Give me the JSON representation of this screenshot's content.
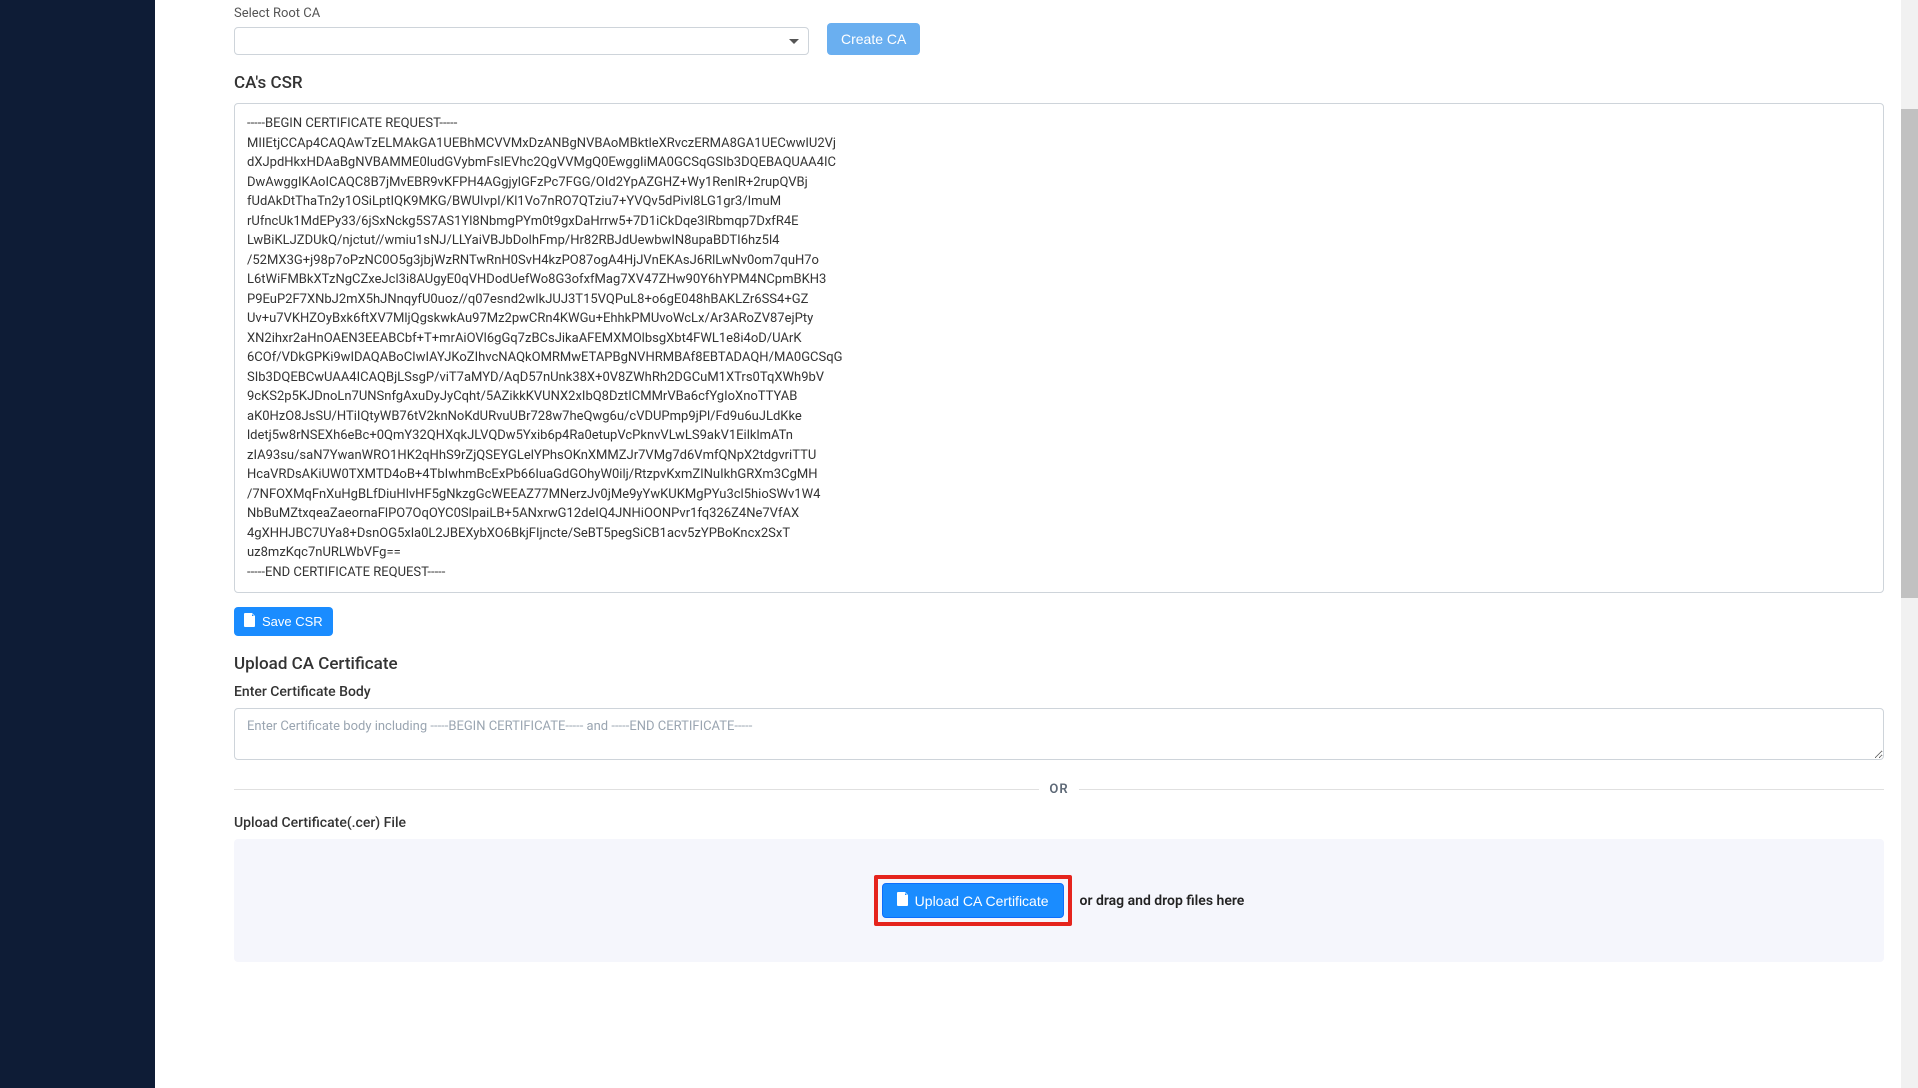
{
  "rootCa": {
    "label": "Select Root CA",
    "value": ""
  },
  "createCaBtn": "Create CA",
  "csr": {
    "heading": "CA's CSR",
    "body": "-----BEGIN CERTIFICATE REQUEST-----\nMIIEtjCCAp4CAQAwTzELMAkGA1UEBhMCVVMxDzANBgNVBAoMBktleXRvczERMA8GA1UECwwIU2Vj\ndXJpdHkxHDAaBgNVBAMME0ludGVybmFsIEVhc2QgVVMgQ0EwggIiMA0GCSqGSIb3DQEBAQUAA4IC\nDwAwggIKAoICAQC8B7jMvEBR9vKFPH4AGgjylGFzPc7FGG/OId2YpAZGHZ+Wy1RenIR+2rupQVBj\nfUdAkDtThaTn2y1OSiLptIQK9MKG/BWUIvpI/Kl1Vo7nRO7QTziu7+YVQv5dPivl8LG1gr3/ImuM\nrUfncUk1MdEPy33/6jSxNckg5S7AS1Yl8NbmgPYm0t9gxDaHrrw5+7D1iCkDqe3lRbmqp7DxfR4E\nLwBiKLJZDUkQ/njctut//wmiu1sNJ/LLYaiVBJbDolhFmp/Hr82RBJdUewbwIN8upaBDTI6hz5l4\n/52MX3G+j98p7oPzNC0O5g3jbjWzRNTwRnH0SvH4kzPO87ogA4HjJVnEKAsJ6RlLwNv0om7quH7o\nL6tWiFMBkXTzNgCZxeJcl3i8AUgyE0qVHDodUefWo8G3ofxfMag7XV47ZHw90Y6hYPM4NCpmBKH3\nP9EuP2F7XNbJ2mX5hJNnqyfU0uoz//q07esnd2wIkJUJ3T15VQPuL8+o6gE048hBAKLZr6SS4+GZ\nUv+u7VKHZOyBxk6ftXV7MljQgskwkAu97Mz2pwCRn4KWGu+EhhkPMUvoWcLx/Ar3ARoZV87ejPty\nXN2ihxr2aHnOAEN3EEABCbf+T+mrAiOVl6gGq7zBCsJikaAFEMXMOlbsgXbt4FWL1e8i4oD/UArK\n6COf/VDkGPKi9wIDAQABoCIwIAYJKoZIhvcNAQkOMRMwETAPBgNVHRMBAf8EBTADAQH/MA0GCSqG\nSIb3DQEBCwUAA4ICAQBjLSsgP/viT7aMYD/AqD57nUnk38X+0V8ZWhRh2DGCuM1XTrs0TqXWh9bV\n9cKS2p5KJDnoLn7UNSnfgAxuDyJyCqht/5AZikkKVUNX2xIbQ8DztICMMrVBa6cfYgIoXnoTTYAB\naK0HzO8JsSU/HTiIQtyWB76tV2knNoKdURvuUBr728w7heQwg6u/cVDUPmp9jPl/Fd9u6uJLdKke\nldetj5w8rNSEXh6eBc+0QmY32QHXqkJLVQDw5Yxib6p4Ra0etupVcPknvVLwLS9akV1EilklmATn\nzIA93su/saN7YwanWRO1HK2qHhS9rZjQSEYGLelYPhsOKnXMMZJr7VMg7d6VmfQNpX2tdgvriTTU\nHcaVRDsAKiUW0TXMTD4oB+4TbIwhmBcExPb66IuaGdGOhyW0ilj/RtzpvKxmZINuIkhGRXm3CgMH\n/7NFOXMqFnXuHgBLfDiuHlvHF5gNkzgGcWEEAZ77MNerzJv0jMe9yYwKUKMgPYu3cl5hioSWv1W4\nNbBuMZtxqeaZaeornaFlPO7OqOYC0SlpaiLB+5ANxrwG12deIQ4JNHiOONPvr1fq326Z4Ne7VfAX\n4gXHHJBC7UYa8+DsnOG5xla0L2JBEXybXO6BkjFIjncte/SeBT5pegSiCB1acv5zYPBoKncx2SxT\nuz8mzKqc7nURLWbVFg==\n-----END CERTIFICATE REQUEST-----",
    "saveBtn": "Save CSR"
  },
  "upload": {
    "heading": "Upload CA Certificate",
    "bodyLabel": "Enter Certificate Body",
    "bodyPlaceholder": "Enter Certificate body including -----BEGIN CERTIFICATE----- and -----END CERTIFICATE-----",
    "or": "OR",
    "fileLabel": "Upload Certificate(.cer) File",
    "uploadBtn": "Upload CA Certificate",
    "dragText": "or drag and drop files here"
  }
}
